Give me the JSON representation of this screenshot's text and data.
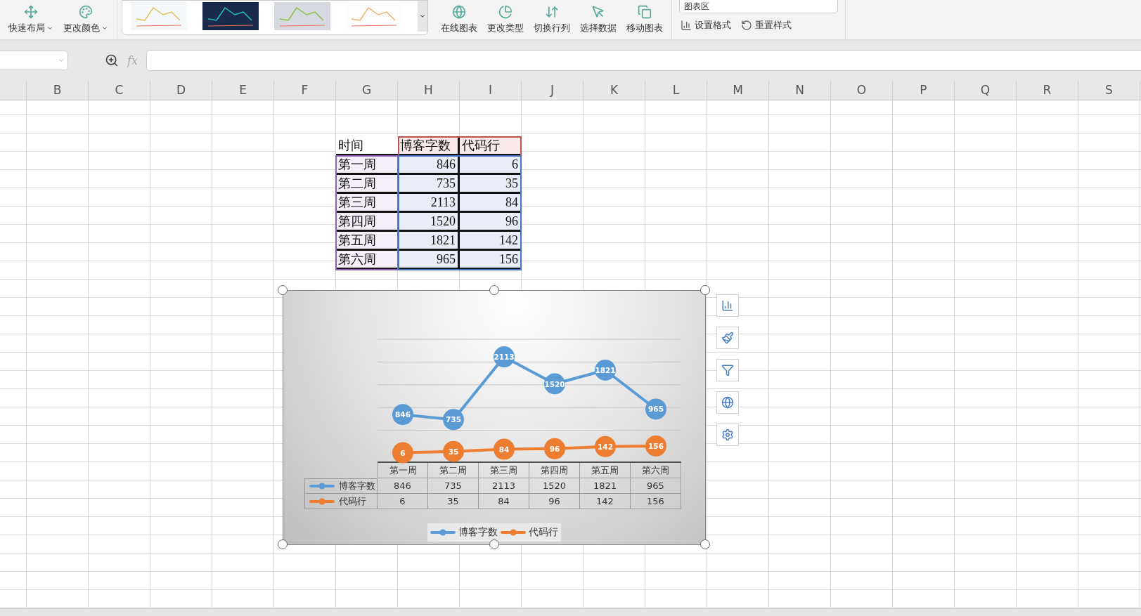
{
  "ribbon": {
    "layout_buttons": [
      {
        "label": "快速布局",
        "kind": "layout",
        "dropdown": true
      },
      {
        "label": "更改颜色",
        "kind": "color",
        "dropdown": true
      }
    ],
    "style_gallery": [
      {
        "kind": "light"
      },
      {
        "kind": "dark"
      },
      {
        "kind": "grey"
      },
      {
        "kind": "plain"
      }
    ],
    "chart_buttons": [
      {
        "label": "在线图表",
        "kind": "online"
      },
      {
        "label": "更改类型",
        "kind": "type"
      },
      {
        "label": "切换行列",
        "kind": "switch"
      },
      {
        "label": "选择数据",
        "kind": "select"
      },
      {
        "label": "移动图表",
        "kind": "move"
      }
    ],
    "element_select": {
      "value": "图表区"
    },
    "format_buttons": [
      {
        "label": "设置格式",
        "kind": "format"
      },
      {
        "label": "重置样式",
        "kind": "reset"
      }
    ]
  },
  "formula_bar": {
    "fx_label": "fx"
  },
  "column_headers": [
    "B",
    "C",
    "D",
    "E",
    "F",
    "G",
    "H",
    "I",
    "J",
    "K",
    "L",
    "M",
    "N",
    "O",
    "P",
    "Q",
    "R",
    "S"
  ],
  "sheet_table": {
    "header": [
      "时间",
      "博客字数",
      "代码行"
    ],
    "rows": [
      [
        "第一周",
        "846",
        "6"
      ],
      [
        "第二周",
        "735",
        "35"
      ],
      [
        "第三周",
        "2113",
        "84"
      ],
      [
        "第四周",
        "1520",
        "96"
      ],
      [
        "第五周",
        "1821",
        "142"
      ],
      [
        "第六周",
        "965",
        "156"
      ]
    ]
  },
  "chart": {
    "selected": true,
    "chart_data": {
      "type": "line",
      "categories": [
        "第一周",
        "第二周",
        "第三周",
        "第四周",
        "第五周",
        "第六周"
      ],
      "legend": true,
      "series": [
        {
          "name": "博客字数",
          "color": "#5b9bd5",
          "marker": "circle",
          "values": [
            846,
            735,
            2113,
            1520,
            1821,
            965
          ],
          "value_labels": [
            "846",
            "735",
            "2113",
            "1520",
            "1821",
            "965"
          ]
        },
        {
          "name": "代码行",
          "color": "#ed7d31",
          "marker": "circle",
          "values": [
            6,
            35,
            84,
            96,
            142,
            156
          ],
          "value_labels": [
            "6",
            "35",
            "84",
            "96",
            "142",
            "156"
          ]
        }
      ]
    },
    "data_table": [
      {
        "name": "博客字数",
        "values": [
          "846",
          "735",
          "2113",
          "1520",
          "1821",
          "965"
        ]
      },
      {
        "name": "代码行",
        "values": [
          "6",
          "35",
          "84",
          "96",
          "142",
          "156"
        ]
      }
    ],
    "side_tools": [
      {
        "kind": "elements"
      },
      {
        "kind": "style"
      },
      {
        "kind": "filter"
      },
      {
        "kind": "online"
      },
      {
        "kind": "settings"
      }
    ]
  }
}
